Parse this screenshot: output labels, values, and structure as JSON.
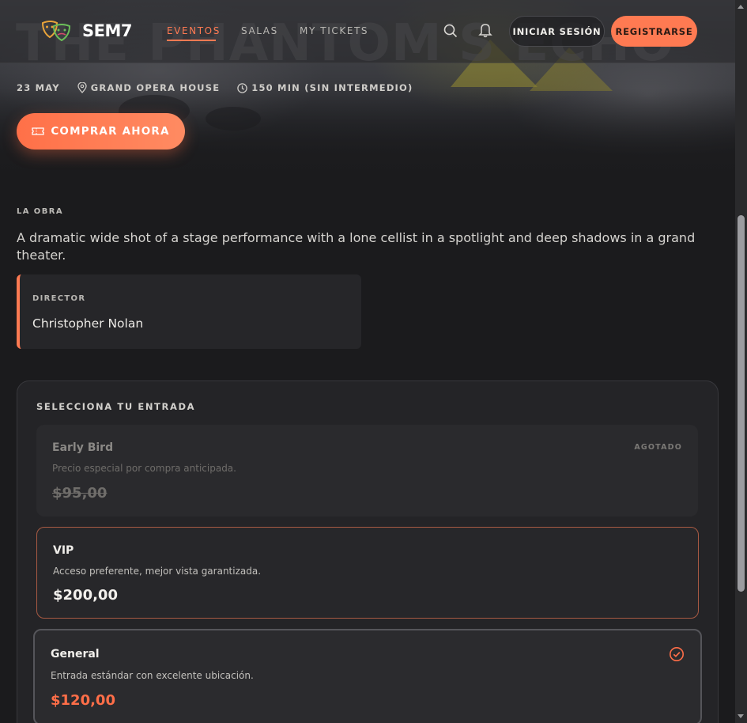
{
  "app": {
    "logo_text": "SEM7"
  },
  "nav": {
    "links": [
      {
        "label": "EVENTOS",
        "active": true
      },
      {
        "label": "SALAS",
        "active": false
      },
      {
        "label": "MY TICKETS",
        "active": false
      }
    ],
    "login_label": "INICIAR SESIÓN",
    "register_label": "REGISTRARSE"
  },
  "hero": {
    "title": "THE PHANTOM'S ECHO",
    "date": "23 MAY",
    "venue": "GRAND OPERA HOUSE",
    "duration": "150 MIN (SIN INTERMEDIO)",
    "buy_label": "COMPRAR AHORA"
  },
  "about": {
    "label": "LA OBRA",
    "synopsis": "A dramatic wide shot of a stage performance with a lone cellist in a spotlight and deep shadows in a grand theater."
  },
  "director": {
    "label": "DIRECTOR",
    "name": "Christopher Nolan"
  },
  "tickets": {
    "heading": "SELECCIONA TU ENTRADA",
    "items": [
      {
        "name": "Early Bird",
        "description": "Precio especial por compra anticipada.",
        "price": "$95,00",
        "badge": "AGOTADO",
        "status": "sold-out"
      },
      {
        "name": "VIP",
        "description": "Acceso preferente, mejor vista garantizada.",
        "price": "$200,00",
        "status": "available"
      },
      {
        "name": "General",
        "description": "Entrada estándar con excelente ubicación.",
        "price": "$120,00",
        "status": "selected"
      }
    ]
  },
  "colors": {
    "accent": "#ff7a52",
    "background": "#1b1b1d",
    "card": "#262629"
  }
}
